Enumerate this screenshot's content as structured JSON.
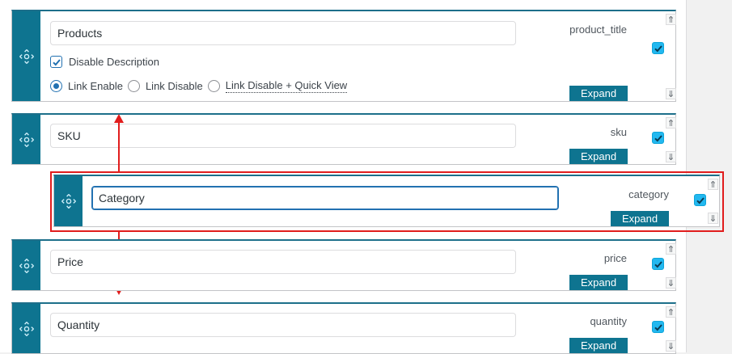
{
  "rows": [
    {
      "id": "products",
      "name_value": "Products",
      "key": "product_title",
      "expand_label": "Expand",
      "checked": true,
      "options": {
        "disable_description_label": "Disable Description",
        "disable_description_checked": true,
        "radios": [
          {
            "label": "Link Enable",
            "selected": true
          },
          {
            "label": "Link Disable",
            "selected": false
          },
          {
            "label": "Link Disable + Quick View",
            "selected": false
          }
        ]
      }
    },
    {
      "id": "sku",
      "name_value": "SKU",
      "key": "sku",
      "expand_label": "Expand",
      "checked": true
    },
    {
      "id": "category",
      "name_value": "Category",
      "key": "category",
      "expand_label": "Expand",
      "checked": true,
      "dragging": true,
      "focused": true
    },
    {
      "id": "price",
      "name_value": "Price",
      "key": "price",
      "expand_label": "Expand",
      "checked": true
    },
    {
      "id": "quantity",
      "name_value": "Quantity",
      "key": "quantity",
      "expand_label": "Expand",
      "checked": true
    }
  ],
  "icons": {
    "drag": "move-arrows-icon",
    "move_up": "⇑",
    "move_down": "⇓",
    "check": "checkmark-icon"
  },
  "colors": {
    "handle": "#0e7490",
    "expand_button": "#0e7490",
    "checkbox_fill": "#22b8f0",
    "focus_border": "#2271b1",
    "highlight": "#e11d1d"
  }
}
